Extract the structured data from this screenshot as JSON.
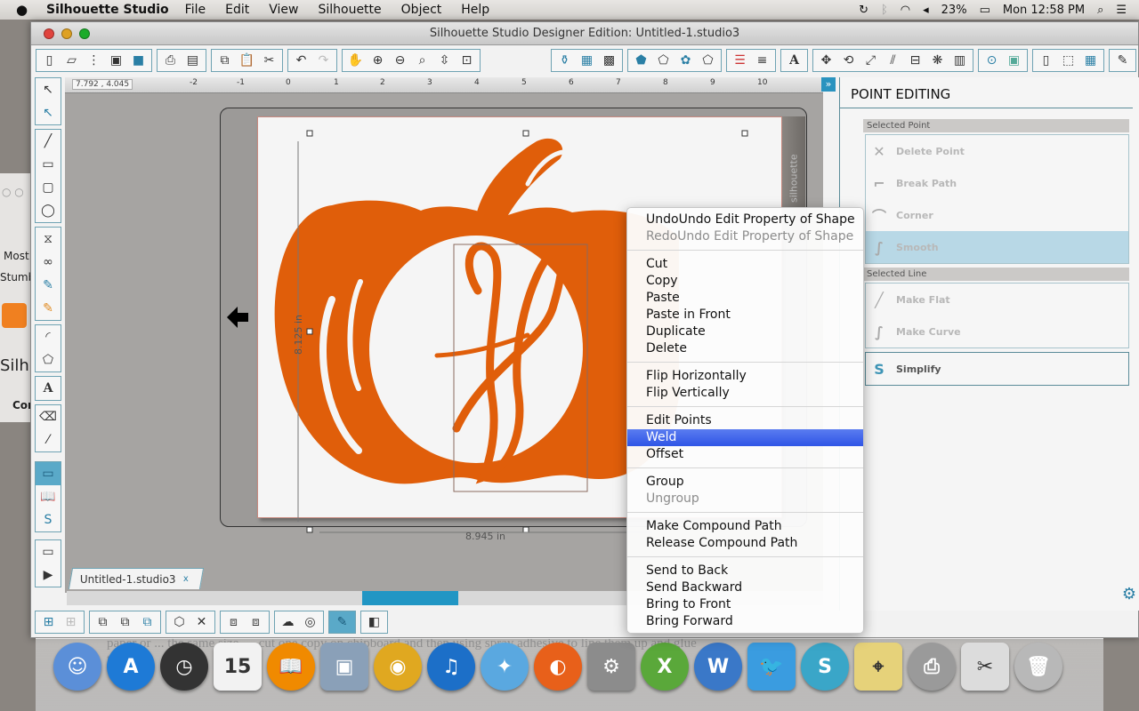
{
  "menubar": {
    "app_name": "Silhouette Studio",
    "items": [
      "File",
      "Edit",
      "View",
      "Silhouette",
      "Object",
      "Help"
    ],
    "battery": "23%",
    "clock": "Mon 12:58 PM"
  },
  "window": {
    "title": "Silhouette Studio Designer Edition: Untitled-1.studio3"
  },
  "toolbar": {
    "groups": [
      [
        "new-document",
        "open",
        "open-library",
        "save",
        "save-to-library"
      ],
      [
        "print",
        "print-and-cut"
      ],
      [
        "copy",
        "paste",
        "cut"
      ],
      [
        "undo",
        "redo"
      ],
      [
        "pan",
        "zoom-in",
        "zoom-out",
        "zoom-select",
        "drag-zoom",
        "fit-to-page"
      ],
      [
        "fill-color",
        "gradient",
        "fill-pattern"
      ],
      [
        "line-color",
        "line-style",
        "sketch",
        "offset-line"
      ],
      [
        "line-width",
        "line-pattern"
      ],
      [
        "text-style"
      ],
      [
        "transform",
        "rotate",
        "scale",
        "shear",
        "align",
        "replicate",
        "modify"
      ],
      [
        "trace",
        "fill-tile"
      ],
      [
        "page-setup",
        "cut-settings",
        "grid"
      ],
      [
        "eraser"
      ]
    ]
  },
  "ruler": {
    "coords": "7.792 , 4.045",
    "ticks": [
      "-2",
      "-1",
      "0",
      "1",
      "2",
      "3",
      "4",
      "5",
      "6",
      "7",
      "8",
      "9",
      "10"
    ]
  },
  "canvas": {
    "width_label": "8.945 in",
    "height_label": "8.125 in",
    "brand_strip": "silhouette",
    "shape_color": "#e05e0a"
  },
  "doc_tab": {
    "label": "Untitled-1.studio3",
    "close": "x"
  },
  "point_editing": {
    "title": "POINT EDITING",
    "selected_point_label": "Selected Point",
    "selected_point_items": [
      {
        "label": "Delete Point",
        "icon": "delete-point-icon",
        "glyph": "✕"
      },
      {
        "label": "Break Path",
        "icon": "break-path-icon",
        "glyph": "⌐"
      },
      {
        "label": "Corner",
        "icon": "corner-icon",
        "glyph": "⌒"
      },
      {
        "label": "Smooth",
        "icon": "smooth-icon",
        "glyph": "∫"
      }
    ],
    "selected_line_label": "Selected Line",
    "selected_line_items": [
      {
        "label": "Make Flat",
        "icon": "make-flat-icon",
        "glyph": "╱"
      },
      {
        "label": "Make Curve",
        "icon": "make-curve-icon",
        "glyph": "∫"
      }
    ],
    "simplify": {
      "label": "Simplify",
      "icon": "simplify-icon",
      "glyph": "S"
    }
  },
  "context_menu": {
    "groups": [
      [
        {
          "label": "UndoUndo Edit Property of Shape"
        },
        {
          "label": "RedoUndo Edit Property of Shape",
          "disabled": true
        }
      ],
      [
        {
          "label": "Cut"
        },
        {
          "label": "Copy"
        },
        {
          "label": "Paste"
        },
        {
          "label": "Paste in Front"
        },
        {
          "label": "Duplicate"
        },
        {
          "label": "Delete"
        }
      ],
      [
        {
          "label": "Flip Horizontally"
        },
        {
          "label": "Flip Vertically"
        }
      ],
      [
        {
          "label": "Edit Points"
        },
        {
          "label": "Weld",
          "highlighted": true
        },
        {
          "label": "Offset"
        }
      ],
      [
        {
          "label": "Group"
        },
        {
          "label": "Ungroup",
          "disabled": true
        }
      ],
      [
        {
          "label": "Make Compound Path"
        },
        {
          "label": "Release Compound Path"
        }
      ],
      [
        {
          "label": "Send to Back"
        },
        {
          "label": "Send Backward"
        },
        {
          "label": "Bring to Front"
        },
        {
          "label": "Bring Forward"
        }
      ]
    ]
  },
  "background_window": {
    "most": "Most",
    "stumble": "Stumbl",
    "silh": "Silh",
    "con": "Con"
  },
  "background_text": "paper or ... the same size, ... cut one copy on chipboard and then using spray adhesive to line them up and glue together",
  "dock": {
    "apps": [
      {
        "name": "finder",
        "glyph": "☺",
        "color": "#5b8fd8"
      },
      {
        "name": "app-store",
        "glyph": "A",
        "color": "#1e7ad6"
      },
      {
        "name": "dashboard",
        "glyph": "◷",
        "color": "#333333"
      },
      {
        "name": "calendar",
        "glyph": "15",
        "color": "#f2f2f2"
      },
      {
        "name": "ibooks",
        "glyph": "📖",
        "color": "#f08a00"
      },
      {
        "name": "iphoto",
        "glyph": "▣",
        "color": "#8aa0b8"
      },
      {
        "name": "chrome",
        "glyph": "◉",
        "color": "#e0a820"
      },
      {
        "name": "itunes",
        "glyph": "♫",
        "color": "#1c6fc8"
      },
      {
        "name": "safari",
        "glyph": "✦",
        "color": "#5aa8e0"
      },
      {
        "name": "firefox",
        "glyph": "◐",
        "color": "#e8601a"
      },
      {
        "name": "system-preferences",
        "glyph": "⚙",
        "color": "#8c8c8c"
      },
      {
        "name": "excel",
        "glyph": "X",
        "color": "#5aa83a"
      },
      {
        "name": "word",
        "glyph": "W",
        "color": "#3a78c8"
      },
      {
        "name": "twitter",
        "glyph": "🐦",
        "color": "#3a9ce0"
      },
      {
        "name": "silhouette-studio",
        "glyph": "S",
        "color": "#3aa6c8"
      },
      {
        "name": "maps",
        "glyph": "⌖",
        "color": "#e6d27a"
      },
      {
        "name": "printer",
        "glyph": "⎙",
        "color": "#9a9a9a"
      },
      {
        "name": "grab",
        "glyph": "✂",
        "color": "#dcdcdc"
      },
      {
        "name": "trash",
        "glyph": "🗑",
        "color": "#b8b8b8"
      }
    ]
  }
}
